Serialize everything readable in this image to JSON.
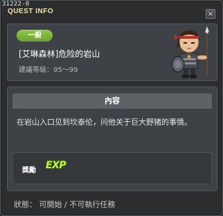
{
  "window": {
    "quest_id": "31222-0",
    "title": "QUEST INFO",
    "close_glyph": "×"
  },
  "quest": {
    "category_badge": "一般",
    "name": "[艾琳森林]危险的岩山",
    "level_text": "建議等級：95～99",
    "npc_icon": "spear-warrior-npc-icon"
  },
  "content": {
    "header": "內容",
    "text": "在岩山入口见到坎泰伦，问他关于巨大野猪的事情。"
  },
  "reward": {
    "label": "獎勵",
    "exp_label": "EXP"
  },
  "status": {
    "text": "狀態： 可開始 / 不可執行任務"
  },
  "colors": {
    "badge_green": "#7cb53a",
    "title_yellow": "#f1e6a8",
    "exp_green": "#c6f24a"
  }
}
